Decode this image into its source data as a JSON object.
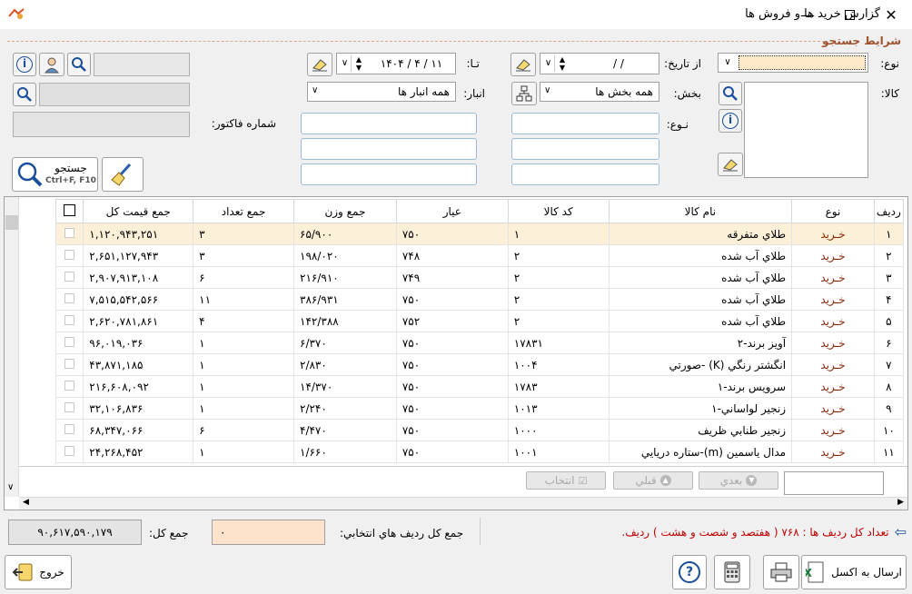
{
  "window": {
    "title": "گزارش  خريد ها و فروش ها"
  },
  "search": {
    "section_label": "شرايط جستجو",
    "type_label": "نوع:",
    "type_value": "",
    "from_date_label": "از تاريخ:",
    "from_date_value": "/      /",
    "to_date_label": "تـا:",
    "to_date_value": "۱۱ / ۴ / ۱۴۰۴",
    "section_field_label": "بخش:",
    "section_value": "همه بخش ها",
    "warehouse_label": "انبار:",
    "warehouse_value": "همه انبار ها",
    "goods_label": "کالا:",
    "kind_label": "نـوع:",
    "invoice_label": "شماره فاکتور:",
    "search_button": "جستجو",
    "search_shortcut": "Ctrl+F, F10"
  },
  "table": {
    "headers": [
      "رديف",
      "نوع",
      "نام کالا",
      "کد کالا",
      "عيار",
      "جمع وزن",
      "جمع تعداد",
      "جمع قيمت کل"
    ],
    "rows": [
      {
        "row": "۱",
        "type": "خـريد",
        "name": "طلاي متفرقه",
        "code": "۱",
        "karat": "۷۵۰",
        "weight": "۶۵/۹۰۰",
        "count": "۳",
        "total": "۱,۱۲۰,۹۴۳,۲۵۱"
      },
      {
        "row": "۲",
        "type": "خـريد",
        "name": "طلاي آب شده",
        "code": "۲",
        "karat": "۷۴۸",
        "weight": "۱۹۸/۰۲۰",
        "count": "۳",
        "total": "۲,۶۵۱,۱۲۷,۹۴۳"
      },
      {
        "row": "۳",
        "type": "خـريد",
        "name": "طلاي آب شده",
        "code": "۲",
        "karat": "۷۴۹",
        "weight": "۲۱۶/۹۱۰",
        "count": "۶",
        "total": "۲,۹۰۷,۹۱۳,۱۰۸"
      },
      {
        "row": "۴",
        "type": "خـريد",
        "name": "طلاي آب شده",
        "code": "۲",
        "karat": "۷۵۰",
        "weight": "۳۸۶/۹۳۱",
        "count": "۱۱",
        "total": "۷,۵۱۵,۵۴۲,۵۶۶"
      },
      {
        "row": "۵",
        "type": "خـريد",
        "name": "طلاي آب شده",
        "code": "۲",
        "karat": "۷۵۲",
        "weight": "۱۴۲/۳۸۸",
        "count": "۴",
        "total": "۲,۶۲۰,۷۸۱,۸۶۱"
      },
      {
        "row": "۶",
        "type": "خـريد",
        "name": "آويز برند-۲",
        "code": "۱۷۸۳۱",
        "karat": "۷۵۰",
        "weight": "۶/۳۷۰",
        "count": "۱",
        "total": "۹۶,۰۱۹,۰۳۶"
      },
      {
        "row": "۷",
        "type": "خـريد",
        "name": "انگشتر رنگي (K) -صورتي",
        "code": "۱۰۰۴",
        "karat": "۷۵۰",
        "weight": "۲/۸۳۰",
        "count": "۱",
        "total": "۴۳,۸۷۱,۱۸۵"
      },
      {
        "row": "۸",
        "type": "خـريد",
        "name": "سرويس برند-۱",
        "code": "۱۷۸۳",
        "karat": "۷۵۰",
        "weight": "۱۴/۳۷۰",
        "count": "۱",
        "total": "۲۱۶,۶۰۸,۰۹۲"
      },
      {
        "row": "۹",
        "type": "خـريد",
        "name": "زنجير لواساني-۱",
        "code": "۱۰۱۳",
        "karat": "۷۵۰",
        "weight": "۲/۲۴۰",
        "count": "۱",
        "total": "۳۲,۱۰۶,۸۳۶"
      },
      {
        "row": "۱۰",
        "type": "خـريد",
        "name": "زنجير طنابي ظريف",
        "code": "۱۰۰۰",
        "karat": "۷۵۰",
        "weight": "۴/۴۷۰",
        "count": "۶",
        "total": "۶۸,۳۴۷,۰۶۶"
      },
      {
        "row": "۱۱",
        "type": "خـريد",
        "name": "مدال ياسمين (m)-ستاره دريايي",
        "code": "۱۰۰۱",
        "karat": "۷۵۰",
        "weight": "۱/۶۶۰",
        "count": "۱",
        "total": "۲۴,۲۶۸,۴۵۲"
      }
    ]
  },
  "nav": {
    "next": "بعدي",
    "prev": "قبلي",
    "select": "انتخاب"
  },
  "footer": {
    "row_count_text": "تعداد کل رديف ها : ۷۶۸ ( هفتصد و شصت و هشت ) رديف.",
    "selected_sum_label": "جمع کل رديف هاي انتخابي:",
    "selected_sum_value": "۰",
    "total_label": "جمع کل:",
    "total_value": "۹۰,۶۱۷,۵۹۰,۱۷۹",
    "excel_button": "ارسال به اکسل",
    "exit_button": "خروج"
  }
}
